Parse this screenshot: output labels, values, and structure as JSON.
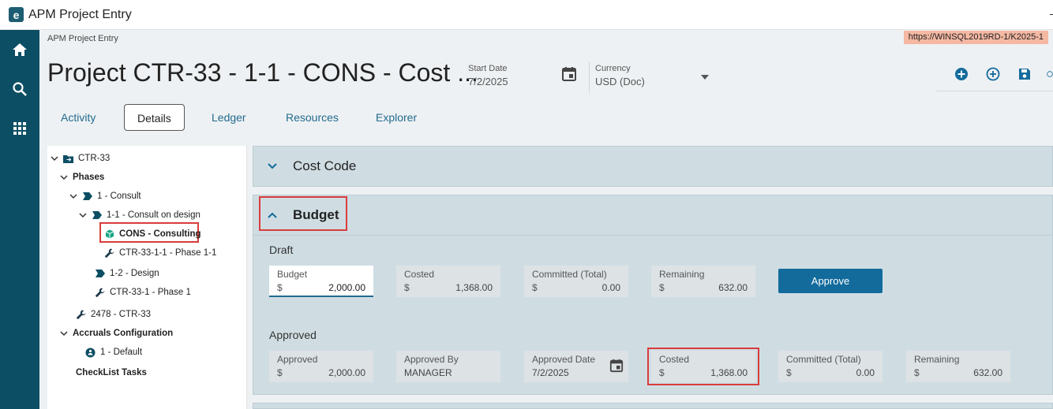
{
  "window": {
    "title": "APM Project Entry",
    "logo_letter": "e"
  },
  "rail": {
    "items": [
      "home-icon",
      "search-icon",
      "grid-icon"
    ],
    "color": "#0c4e63"
  },
  "header": {
    "breadcrumb": "APM Project Entry",
    "url": "https://WINSQL2019RD-1/K2025-1",
    "page_title": "Project CTR-33 - 1-1 - CONS - Cost ...",
    "start_date_label": "Start Date",
    "start_date_value": "7/2/2025",
    "currency_label": "Currency",
    "currency_value": "USD (Doc)"
  },
  "tabs": [
    {
      "label": "Activity",
      "active": false
    },
    {
      "label": "Details",
      "active": true
    },
    {
      "label": "Ledger",
      "active": false
    },
    {
      "label": "Resources",
      "active": false
    },
    {
      "label": "Explorer",
      "active": false
    }
  ],
  "tree": {
    "root": "CTR-33",
    "phases": "Phases",
    "consult": "1 - Consult",
    "consult_design": "1-1 - Consult on design",
    "cons": "CONS - Consulting",
    "ctr_phase_1_1": "CTR-33-1-1 - Phase 1-1",
    "design": "1-2 - Design",
    "ctr_phase_1": "CTR-33-1 - Phase 1",
    "job": "2478 - CTR-33",
    "accruals": "Accruals Configuration",
    "default": "1 - Default",
    "checklist": "CheckList Tasks"
  },
  "sections": {
    "cost_code": "Cost Code",
    "budget": "Budget"
  },
  "draft": {
    "label": "Draft",
    "budget_label": "Budget",
    "budget_cur": "$",
    "budget_value": "2,000.00",
    "costed_label": "Costed",
    "costed_cur": "$",
    "costed_value": "1,368.00",
    "committed_label": "Committed (Total)",
    "committed_cur": "$",
    "committed_value": "0.00",
    "remaining_label": "Remaining",
    "remaining_cur": "$",
    "remaining_value": "632.00",
    "approve_button": "Approve"
  },
  "approved": {
    "label": "Approved",
    "approved_label": "Approved",
    "approved_cur": "$",
    "approved_value": "2,000.00",
    "approved_by_label": "Approved By",
    "approved_by_value": "MANAGER",
    "approved_date_label": "Approved Date",
    "approved_date_value": "7/2/2025",
    "costed_label": "Costed",
    "costed_cur": "$",
    "costed_value": "1,368.00",
    "committed_label": "Committed (Total)",
    "committed_cur": "$",
    "committed_value": "0.00",
    "remaining_label": "Remaining",
    "remaining_cur": "$",
    "remaining_value": "632.00"
  },
  "colors": {
    "accent": "#136b9c",
    "highlight": "#d93c3c",
    "panel": "#cfdde3"
  }
}
